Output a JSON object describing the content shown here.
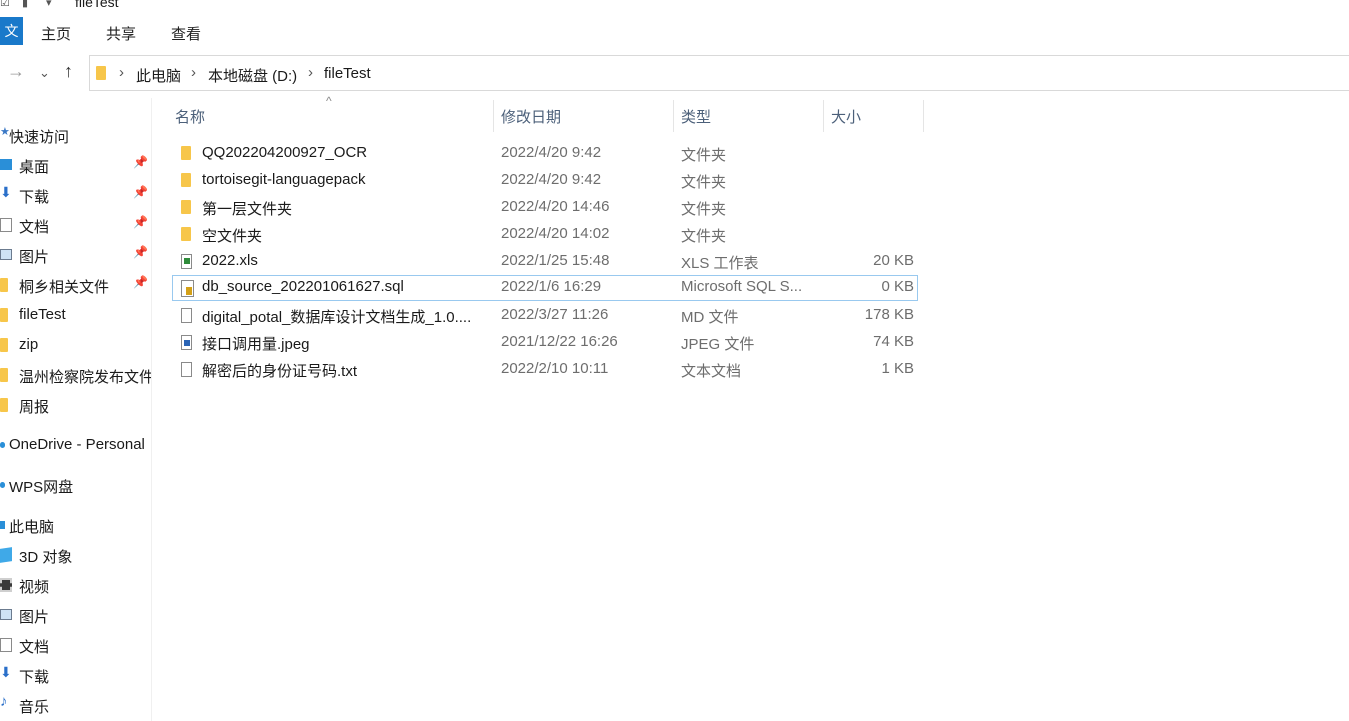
{
  "window": {
    "title": "fileTest"
  },
  "ribbon": {
    "file_tab": "文件",
    "tabs": [
      "主页",
      "共享",
      "查看"
    ]
  },
  "address": {
    "crumbs": [
      "此电脑",
      "本地磁盘 (D:)",
      "fileTest"
    ]
  },
  "sidebar": {
    "items": [
      {
        "label": "快速访问",
        "icon": "star-icon",
        "pinned": false
      },
      {
        "label": "桌面",
        "icon": "desktop-icon",
        "pinned": true
      },
      {
        "label": "下载",
        "icon": "download-icon",
        "pinned": true
      },
      {
        "label": "文档",
        "icon": "document-icon",
        "pinned": true
      },
      {
        "label": "图片",
        "icon": "picture-icon",
        "pinned": true
      },
      {
        "label": "桐乡相关文件",
        "icon": "folder-icon",
        "pinned": true
      },
      {
        "label": "fileTest",
        "icon": "folder-icon",
        "pinned": false
      },
      {
        "label": "zip",
        "icon": "folder-icon",
        "pinned": false
      },
      {
        "label": "温州检察院发布文件",
        "icon": "folder-icon",
        "pinned": false
      },
      {
        "label": "周报",
        "icon": "folder-icon",
        "pinned": false
      },
      {
        "label": "OneDrive - Personal",
        "icon": "cloud-icon",
        "pinned": false
      },
      {
        "label": "WPS网盘",
        "icon": "cloud-icon",
        "pinned": false
      },
      {
        "label": "此电脑",
        "icon": "computer-icon",
        "pinned": false
      },
      {
        "label": "3D 对象",
        "icon": "cube-icon",
        "pinned": false
      },
      {
        "label": "视频",
        "icon": "video-icon",
        "pinned": false
      },
      {
        "label": "图片",
        "icon": "picture-icon",
        "pinned": false
      },
      {
        "label": "文档",
        "icon": "document-icon",
        "pinned": false
      },
      {
        "label": "下载",
        "icon": "download-icon",
        "pinned": false
      },
      {
        "label": "音乐",
        "icon": "music-icon",
        "pinned": false
      }
    ]
  },
  "columns": {
    "name": "名称",
    "modified": "修改日期",
    "type": "类型",
    "size": "大小"
  },
  "files": [
    {
      "name": "QQ202204200927_OCR",
      "modified": "2022/4/20 9:42",
      "type": "文件夹",
      "size": "",
      "icon": "folder-icon"
    },
    {
      "name": "tortoisegit-languagepack",
      "modified": "2022/4/20 9:42",
      "type": "文件夹",
      "size": "",
      "icon": "folder-icon"
    },
    {
      "name": "第一层文件夹",
      "modified": "2022/4/20 14:46",
      "type": "文件夹",
      "size": "",
      "icon": "folder-icon"
    },
    {
      "name": "空文件夹",
      "modified": "2022/4/20 14:02",
      "type": "文件夹",
      "size": "",
      "icon": "folder-icon"
    },
    {
      "name": "2022.xls",
      "modified": "2022/1/25 15:48",
      "type": "XLS 工作表",
      "size": "20 KB",
      "icon": "xls-file-icon"
    },
    {
      "name": "db_source_202201061627.sql",
      "modified": "2022/1/6 16:29",
      "type": "Microsoft SQL S...",
      "size": "0 KB",
      "icon": "sql-file-icon",
      "selected": true
    },
    {
      "name": "digital_potal_数据库设计文档生成_1.0....",
      "modified": "2022/3/27 11:26",
      "type": "MD 文件",
      "size": "178 KB",
      "icon": "md-file-icon"
    },
    {
      "name": "接口调用量.jpeg",
      "modified": "2021/12/22 16:26",
      "type": "JPEG 文件",
      "size": "74 KB",
      "icon": "jpeg-file-icon"
    },
    {
      "name": "解密后的身份证号码.txt",
      "modified": "2022/2/10 10:11",
      "type": "文本文档",
      "size": "1 KB",
      "icon": "txt-file-icon"
    }
  ]
}
